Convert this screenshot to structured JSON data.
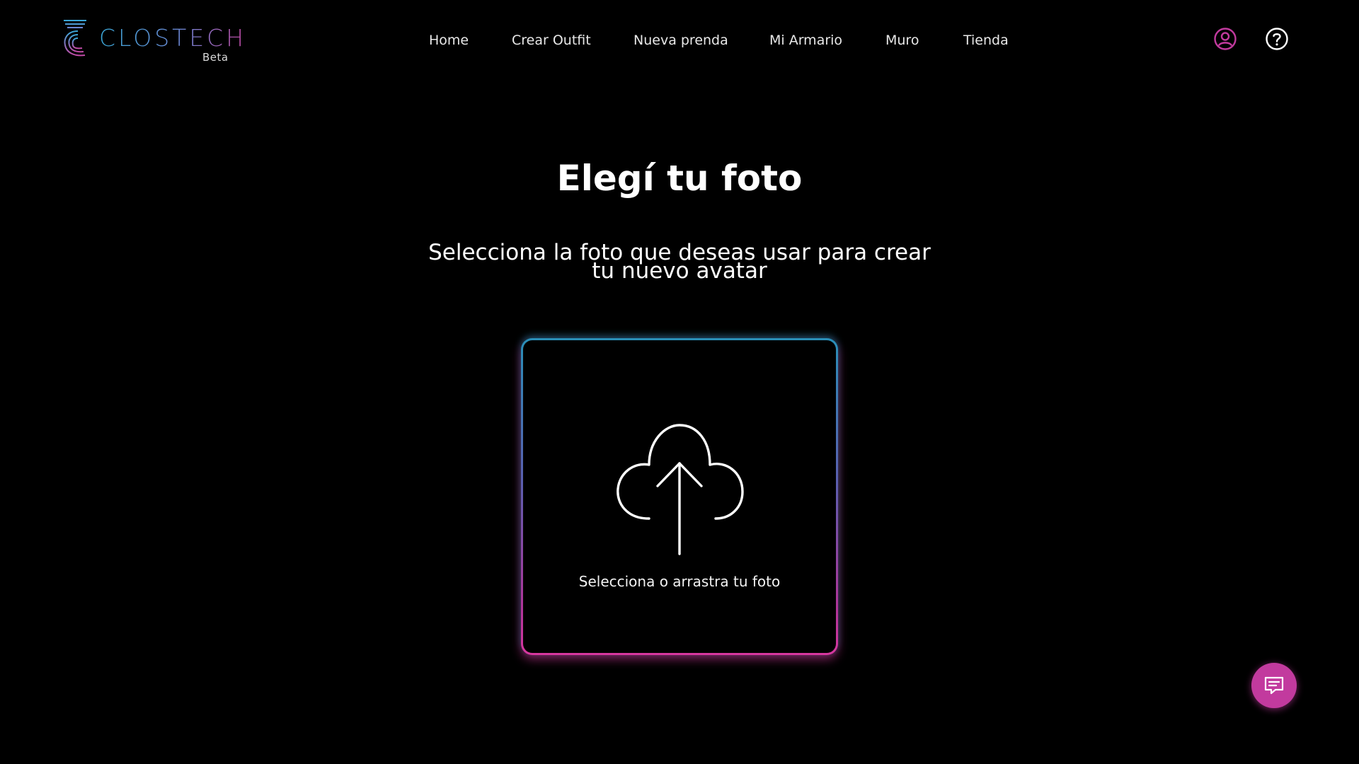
{
  "brand": {
    "name": "CLOSTECH",
    "badge": "Beta"
  },
  "nav": {
    "items": [
      {
        "label": "Home"
      },
      {
        "label": "Crear Outfit"
      },
      {
        "label": "Nueva prenda"
      },
      {
        "label": "Mi Armario"
      },
      {
        "label": "Muro"
      },
      {
        "label": "Tienda"
      }
    ]
  },
  "header_icons": {
    "profile": "user-circle-icon",
    "help": "question-circle-icon"
  },
  "main": {
    "title": "Elegí tu foto",
    "subtitle": "Selecciona la foto que deseas usar para crear tu nuevo avatar",
    "dropzone": {
      "icon": "cloud-upload-icon",
      "label": "Selecciona o arrastra tu foto"
    }
  },
  "chat": {
    "icon": "chat-message-icon"
  },
  "colors": {
    "background": "#000000",
    "accent_pink": "#c23a9e",
    "accent_blue": "#2a8fb8",
    "text": "#ffffff"
  }
}
